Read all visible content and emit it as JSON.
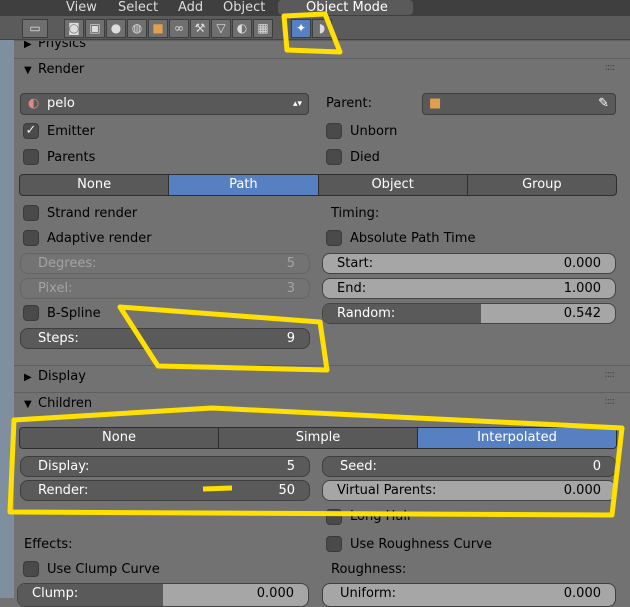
{
  "header": {
    "menu": [
      "View",
      "Select",
      "Add",
      "Object"
    ],
    "mode": "Object Mode"
  },
  "toolbar": {
    "icons": [
      "render-icon",
      "render-layers-icon",
      "scene-icon",
      "world-icon",
      "object-icon",
      "constraints-icon",
      "modifiers-icon",
      "data-icon",
      "material-icon",
      "texture-icon",
      "particles-icon",
      "physics-icon"
    ],
    "active": "particles-icon"
  },
  "panels": {
    "physics": "Physics",
    "render": "Render",
    "display": "Display",
    "children": "Children"
  },
  "render": {
    "material": "pelo",
    "parent_label": "Parent:",
    "emitter": "Emitter",
    "emitter_checked": true,
    "parents": "Parents",
    "unborn": "Unborn",
    "died": "Died",
    "tabs": [
      "None",
      "Path",
      "Object",
      "Group"
    ],
    "active_tab": "Path",
    "strand_render": "Strand render",
    "adaptive_render": "Adaptive render",
    "degrees_label": "Degrees:",
    "degrees": "5",
    "pixel_label": "Pixel:",
    "pixel": "3",
    "bspline": "B-Spline",
    "steps_label": "Steps:",
    "steps": "9",
    "timing": "Timing:",
    "absolute_path_time": "Absolute Path Time",
    "start_label": "Start:",
    "start": "0.000",
    "end_label": "End:",
    "end": "1.000",
    "random_label": "Random:",
    "random": "0.542",
    "random_fraction": 0.542
  },
  "children": {
    "tabs": [
      "None",
      "Simple",
      "Interpolated"
    ],
    "active_tab": "Interpolated",
    "display_label": "Display:",
    "display": "5",
    "render_label": "Render:",
    "render": "50",
    "seed_label": "Seed:",
    "seed": "0",
    "virtual_parents_label": "Virtual Parents:",
    "virtual_parents": "0.000",
    "long_hair": "Long Hair",
    "effects": "Effects:",
    "use_clump_curve": "Use Clump Curve",
    "clump_label": "Clump:",
    "clump": "0.000",
    "use_roughness_curve": "Use Roughness Curve",
    "roughness": "Roughness:",
    "uniform_label": "Uniform:",
    "uniform": "0.000"
  },
  "annotation_color": "#ffe000"
}
